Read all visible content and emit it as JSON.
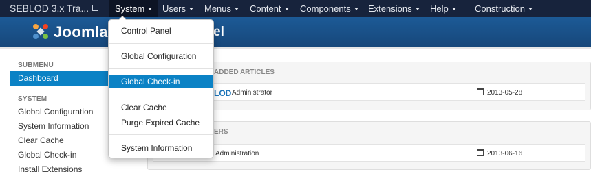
{
  "navbar": {
    "brand": "SEBLOD 3.x Tra...",
    "items": [
      {
        "label": "System"
      },
      {
        "label": "Users"
      },
      {
        "label": "Menus"
      },
      {
        "label": "Content"
      },
      {
        "label": "Components"
      },
      {
        "label": "Extensions"
      },
      {
        "label": "Help"
      },
      {
        "label": "Construction"
      }
    ],
    "active_item": "System"
  },
  "header": {
    "logo_text": "Joomla!",
    "title": "el"
  },
  "system_dropdown": {
    "items": [
      {
        "label": "Control Panel"
      },
      {
        "label": "Global Configuration"
      },
      {
        "label": "Global Check-in"
      },
      {
        "label": "Clear Cache"
      },
      {
        "label": "Purge Expired Cache"
      },
      {
        "label": "System Information"
      }
    ],
    "highlighted": "Global Check-in"
  },
  "sidebar": {
    "submenu_heading": "SUBMENU",
    "submenu_items": [
      {
        "label": "Dashboard"
      }
    ],
    "system_heading": "SYSTEM",
    "system_items": [
      {
        "label": "Global Configuration"
      },
      {
        "label": "System Information"
      },
      {
        "label": "Clear Cache"
      },
      {
        "label": "Global Check-in"
      },
      {
        "label": "Install Extensions"
      }
    ]
  },
  "panels": {
    "articles": {
      "heading": "ADDED ARTICLES",
      "row": {
        "title": "LOD",
        "author": "Administrator",
        "date": "2013-05-28"
      }
    },
    "users": {
      "heading": "ERS",
      "row": {
        "label": "Administration",
        "date": "2013-06-16"
      }
    }
  },
  "colors": {
    "navbar_bg": "#17233c",
    "header_bg": "#1c5a96",
    "accent": "#0b82c5",
    "link": "#1a73b8"
  }
}
